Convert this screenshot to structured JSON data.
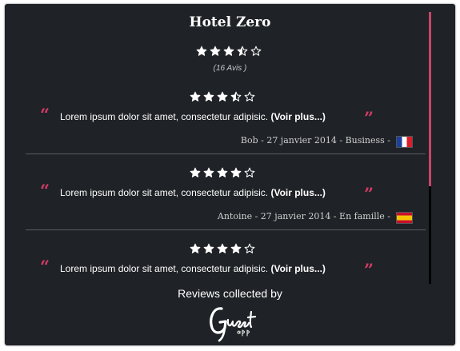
{
  "hotel": {
    "name": "Hotel Zero",
    "rating": 3.5,
    "review_count": "(16 Avis )"
  },
  "colors": {
    "background": "#1f2226",
    "accent": "#d13a66",
    "text": "#ffffff"
  },
  "reviews": [
    {
      "rating": 3.5,
      "open_quote": "“",
      "close_quote": "”",
      "text": "Lorem ipsum dolor sit amet, consectetur adipisic. ",
      "more": "(Voir plus...)",
      "meta": "Bob - 27 janvier 2014 - Business -",
      "flag": "france-flag-icon"
    },
    {
      "rating": 4,
      "open_quote": "“",
      "close_quote": "”",
      "text": "Lorem ipsum dolor sit amet, consectetur adipisic. ",
      "more": "(Voir plus...)",
      "meta": "Antoine - 27 janvier 2014 - En famille -",
      "flag": "spain-flag-icon"
    },
    {
      "rating": 4,
      "open_quote": "“",
      "close_quote": "”",
      "text": "Lorem ipsum dolor sit amet, consectetur adipisic. ",
      "more": "(Voir plus...)"
    }
  ],
  "scrollbar": {
    "position": 0,
    "visible_fraction": 0.64
  },
  "footer": {
    "collected_by": "Reviews collected by",
    "brand_logo_text": "Guest app"
  }
}
